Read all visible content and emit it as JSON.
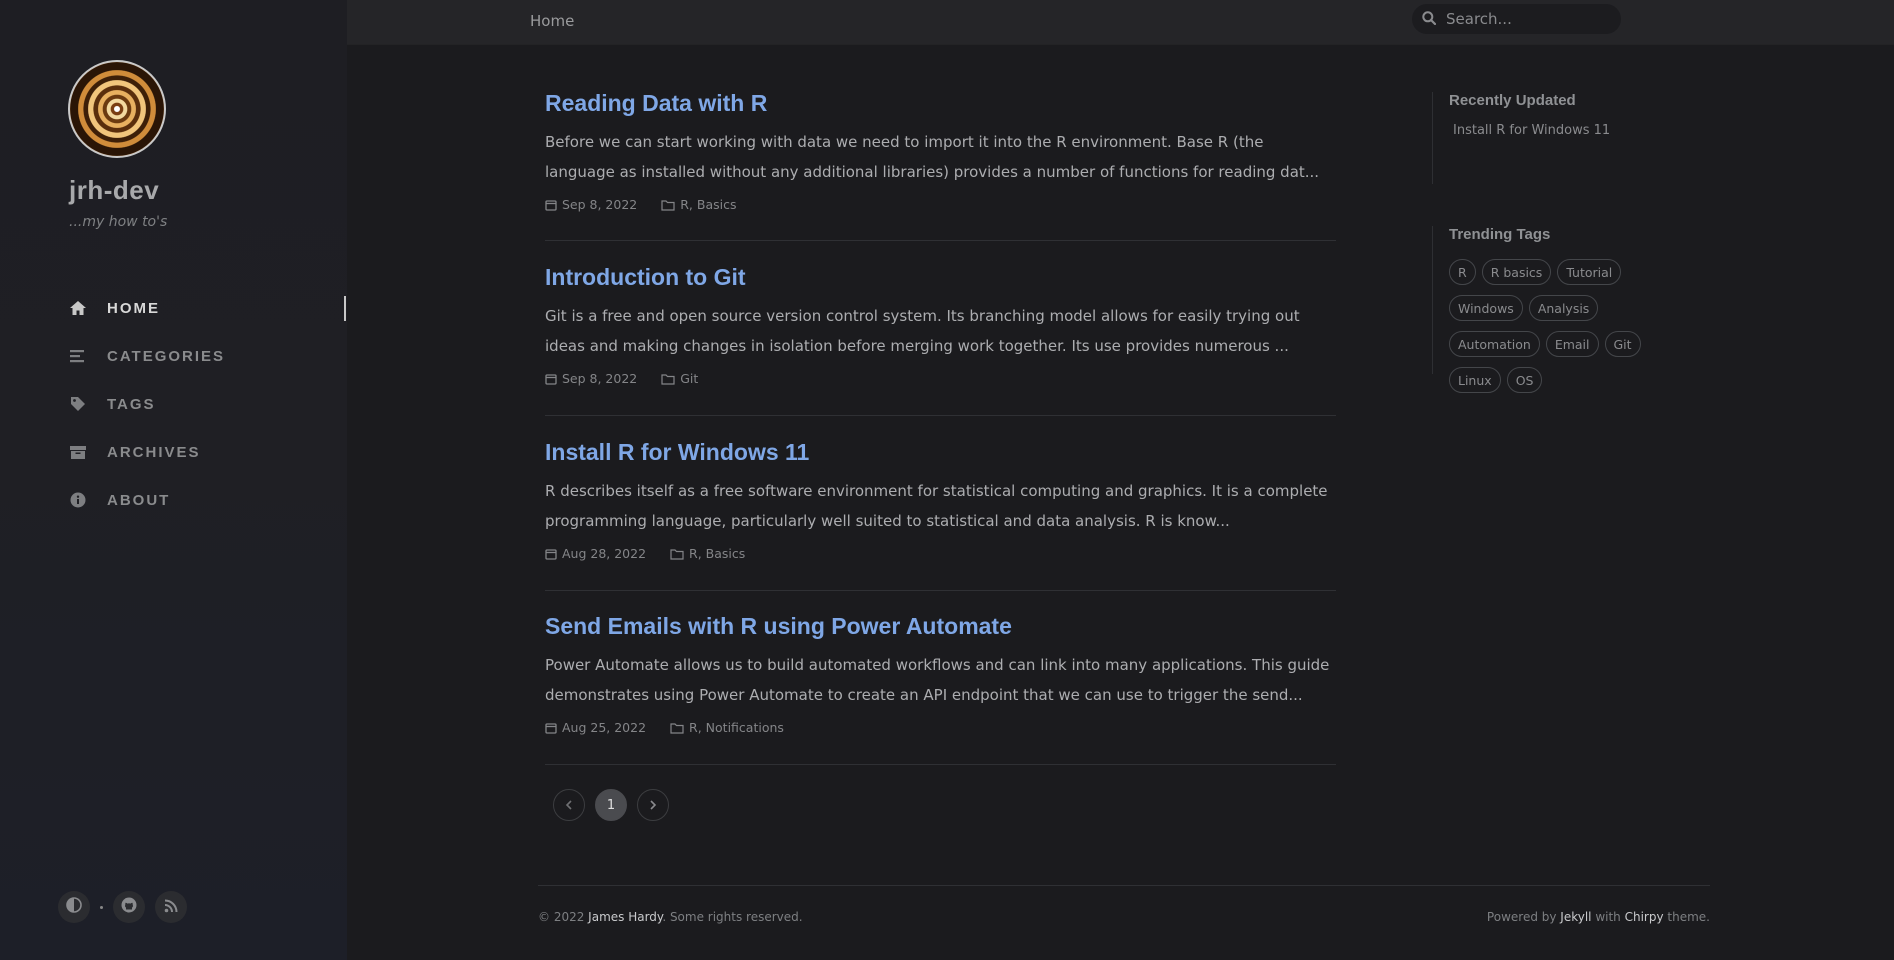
{
  "sidebar": {
    "title": "jrh-dev",
    "subtitle": "...my how to's",
    "nav": [
      {
        "label": "HOME",
        "icon": "home-icon",
        "active": true
      },
      {
        "label": "CATEGORIES",
        "icon": "categories-icon"
      },
      {
        "label": "TAGS",
        "icon": "tag-icon"
      },
      {
        "label": "ARCHIVES",
        "icon": "archive-icon"
      },
      {
        "label": "ABOUT",
        "icon": "info-icon"
      }
    ],
    "bottom_icons": [
      "theme-toggle-icon",
      "github-icon",
      "rss-icon"
    ]
  },
  "topbar": {
    "breadcrumb": "Home",
    "search_placeholder": "Search..."
  },
  "posts": [
    {
      "title": "Reading Data with R",
      "excerpt": "Before we can start working with data we need to import it into the R environment. Base R (the language as installed without any additional libraries) provides a number of functions for reading dat...",
      "date": "Sep 8, 2022",
      "categories": "R, Basics"
    },
    {
      "title": "Introduction to Git",
      "excerpt": "Git is a free and open source version control system. Its branching model allows for easily trying out ideas and making changes in isolation before merging work together. Its use provides numerous ...",
      "date": "Sep 8, 2022",
      "categories": "Git"
    },
    {
      "title": "Install R for Windows 11",
      "excerpt": "R describes itself as a free software environment for statistical computing and graphics. It is a complete programming language, particularly well suited to statistical and data analysis. R is know...",
      "date": "Aug 28, 2022",
      "categories": "R, Basics"
    },
    {
      "title": "Send Emails with R using Power Automate",
      "excerpt": "Power Automate allows us to build automated workflows and can link into many applications. This guide demonstrates using Power Automate to create an API endpoint that we can use to trigger the send...",
      "date": "Aug 25, 2022",
      "categories": "R, Notifications"
    }
  ],
  "pagination": {
    "current": "1"
  },
  "panel": {
    "recent_heading": "Recently Updated",
    "recent": [
      "Install R for Windows 11"
    ],
    "tags_heading": "Trending Tags",
    "tags": [
      "R",
      "R basics",
      "Tutorial",
      "Windows",
      "Analysis",
      "Automation",
      "Email",
      "Git",
      "Linux",
      "OS"
    ]
  },
  "footer": {
    "copyright_prefix": "© 2022 ",
    "author": "James Hardy",
    "rights": ". Some rights reserved.",
    "powered_prefix": "Powered by ",
    "jekyll": "Jekyll",
    "with": " with ",
    "chirpy": "Chirpy",
    "theme": " theme."
  },
  "colors": {
    "link": "#7fa7e6",
    "background": "#1b1b1e",
    "sidebar": "#1e1e23"
  }
}
